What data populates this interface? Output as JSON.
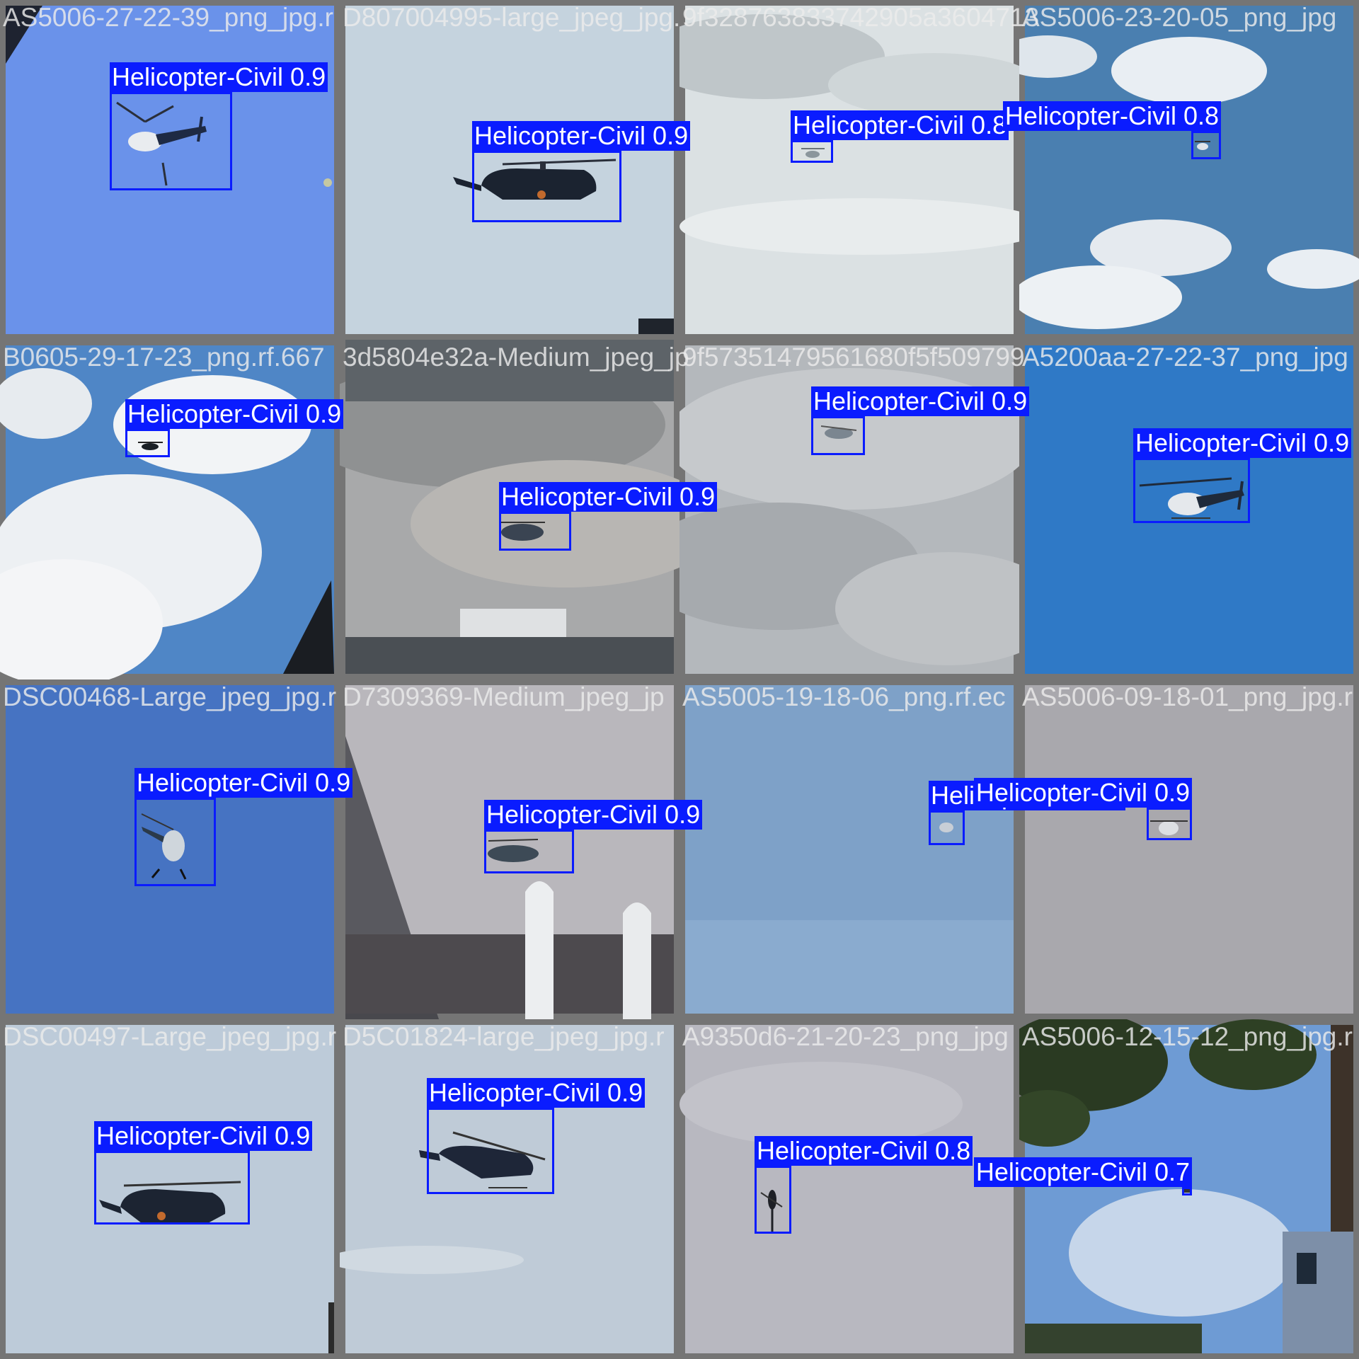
{
  "grid": {
    "tiles": [
      {
        "name": "tile-1",
        "filename": "AS5006-27-22-39_png_jpg.r",
        "detection": {
          "label": "Helicopter-Civil 0.9",
          "cls": "Helicopter-Civil",
          "conf": 0.9
        }
      },
      {
        "name": "tile-2",
        "filename": "D807004995-large_jpeg_jpg.",
        "detection": {
          "label": "Helicopter-Civil 0.9",
          "cls": "Helicopter-Civil",
          "conf": 0.9
        }
      },
      {
        "name": "tile-3",
        "filename": "9f328763833742905a3604713",
        "detection": {
          "label": "Helicopter-Civil 0.8",
          "cls": "Helicopter-Civil",
          "conf": 0.8
        }
      },
      {
        "name": "tile-4",
        "filename": "AS5006-23-20-05_png_jpg",
        "detection": {
          "label": "Helicopter-Civil 0.8",
          "cls": "Helicopter-Civil",
          "conf": 0.8
        }
      },
      {
        "name": "tile-5",
        "filename": "B0605-29-17-23_png.rf.667",
        "detection": {
          "label": "Helicopter-Civil 0.9",
          "cls": "Helicopter-Civil",
          "conf": 0.9
        }
      },
      {
        "name": "tile-6",
        "filename": "3d5804e32a-Medium_jpeg_jp",
        "detection": {
          "label": "Helicopter-Civil 0.9",
          "cls": "Helicopter-Civil",
          "conf": 0.9
        }
      },
      {
        "name": "tile-7",
        "filename": "9f57351479561680f5f509799",
        "detection": {
          "label": "Helicopter-Civil 0.9",
          "cls": "Helicopter-Civil",
          "conf": 0.9
        }
      },
      {
        "name": "tile-8",
        "filename": "A5200aa-27-22-37_png_jpg",
        "detection": {
          "label": "Helicopter-Civil 0.9",
          "cls": "Helicopter-Civil",
          "conf": 0.9
        }
      },
      {
        "name": "tile-9",
        "filename": "DSC00468-Large_jpeg_jpg.r",
        "detection": {
          "label": "Helicopter-Civil 0.9",
          "cls": "Helicopter-Civil",
          "conf": 0.9
        }
      },
      {
        "name": "tile-10",
        "filename": "D7309369-Medium_jpeg_jp",
        "detection": {
          "label": "Helicopter-Civil 0.9",
          "cls": "Helicopter-Civil",
          "conf": 0.9
        }
      },
      {
        "name": "tile-11",
        "filename": "AS5005-19-18-06_png.rf.ec",
        "detection": {
          "label": "Helicopter-Civil 0",
          "cls": "Helicopter-Civil",
          "conf": 0
        }
      },
      {
        "name": "tile-12",
        "filename": "AS5006-09-18-01_png_jpg.r",
        "detection": {
          "label": "Helicopter-Civil 0.9",
          "cls": "Helicopter-Civil",
          "conf": 0.9
        }
      },
      {
        "name": "tile-13",
        "filename": "DSC00497-Large_jpeg_jpg.r",
        "detection": {
          "label": "Helicopter-Civil 0.9",
          "cls": "Helicopter-Civil",
          "conf": 0.9
        }
      },
      {
        "name": "tile-14",
        "filename": "D5C01824-large_jpeg_jpg.r",
        "detection": {
          "label": "Helicopter-Civil 0.9",
          "cls": "Helicopter-Civil",
          "conf": 0.9
        }
      },
      {
        "name": "tile-15",
        "filename": "A9350d6-21-20-23_png_jpg",
        "detection": {
          "label": "Helicopter-Civil 0.8",
          "cls": "Helicopter-Civil",
          "conf": 0.8
        }
      },
      {
        "name": "tile-16",
        "filename": "AS5006-12-15-12_png_jpg.r",
        "detection": {
          "label": "Helicopter-Civil 0.7",
          "cls": "Helicopter-Civil",
          "conf": 0.7
        }
      }
    ]
  },
  "colors": {
    "box": "#0a1cff",
    "label_text": "#ffffff",
    "frame": "#757575"
  }
}
